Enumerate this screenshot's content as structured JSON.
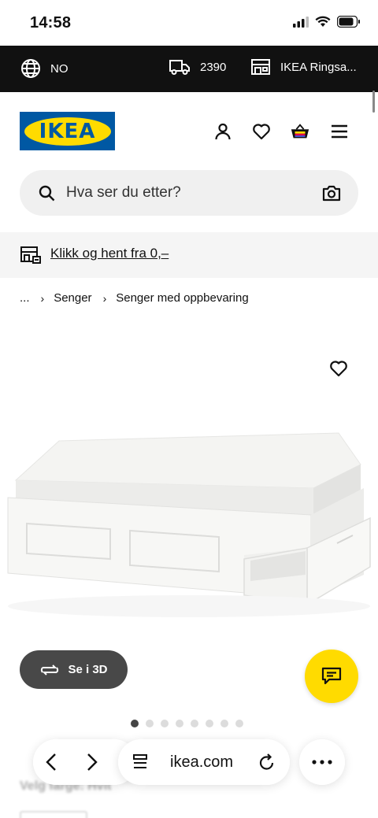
{
  "status": {
    "time": "14:58"
  },
  "topbar": {
    "language": "NO",
    "postcode": "2390",
    "store": "IKEA Ringsa..."
  },
  "header": {
    "logo_text": "IKEA"
  },
  "search": {
    "placeholder": "Hva ser du etter?"
  },
  "collect": {
    "text": "Klikk og hent fra 0,–"
  },
  "breadcrumb": {
    "ellipsis": "...",
    "items": [
      "Senger",
      "Senger med oppbevaring"
    ]
  },
  "product": {
    "view_3d_label": "Se i 3D",
    "image_count": 8,
    "active_image": 1
  },
  "below": {
    "choose_color": "Velg farge: Hvit"
  },
  "browser": {
    "url": "ikea.com"
  },
  "colors": {
    "ikea_blue": "#0058a3",
    "ikea_yellow": "#ffdb00",
    "topbar_bg": "#111111"
  }
}
